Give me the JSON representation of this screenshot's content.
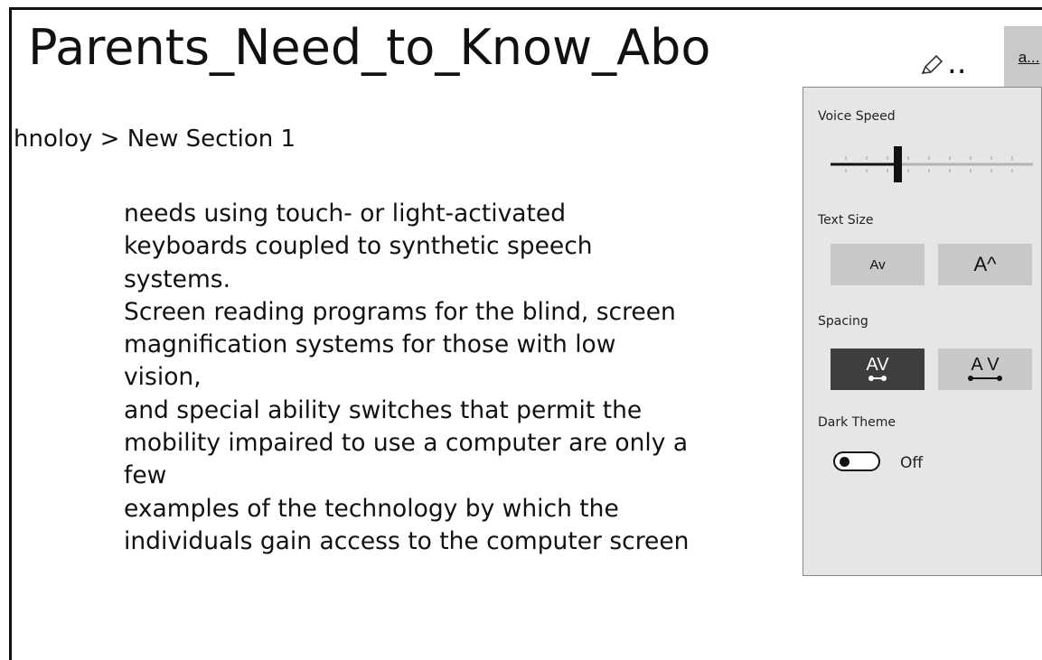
{
  "header": {
    "title": "Parents_Need_to_Know_About_As",
    "ellipsis": "..",
    "reader_button_label": "a..."
  },
  "breadcrumb": "hnoloy > New Section 1",
  "content": {
    "lines": [
      "needs using touch- or light-activated",
      "keyboards coupled to synthetic speech",
      "systems.",
      "Screen reading programs for the blind, screen",
      "magnification systems for those with low",
      "vision,",
      "and special ability switches that permit the",
      "mobility impaired to use a computer are only a",
      "few",
      "examples of the technology by which the",
      "individuals gain access to the computer screen"
    ]
  },
  "settings_panel": {
    "voice_speed": {
      "label": "Voice Speed",
      "level_fraction": 0.33
    },
    "text_size": {
      "label": "Text Size",
      "decrease_label": "Av",
      "increase_label": "A^"
    },
    "spacing": {
      "label": "Spacing",
      "narrow_label": "AV",
      "wide_label": "A V",
      "selected": "narrow"
    },
    "dark_theme": {
      "label": "Dark Theme",
      "state": "Off"
    }
  },
  "colors": {
    "panel_bg": "#e6e6e6",
    "button_bg": "#c8c8c8",
    "selected_button_bg": "#3e3e3e"
  },
  "icons": {
    "edit": "pencil-icon",
    "spacing_narrow": "spacing-narrow-icon",
    "spacing_wide": "spacing-wide-icon"
  }
}
